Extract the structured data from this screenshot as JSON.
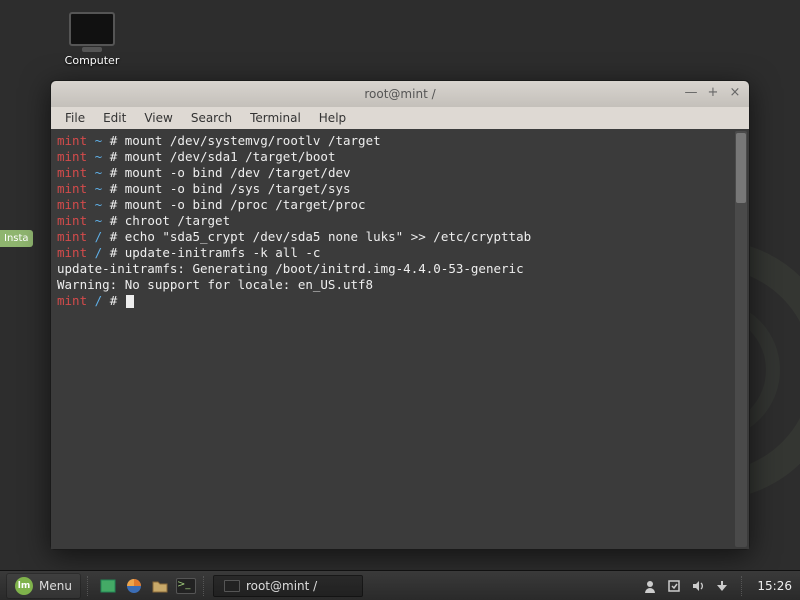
{
  "desktop": {
    "computer_label": "Computer",
    "install_tab": "Insta"
  },
  "window": {
    "title": "root@mint /",
    "menus": {
      "file": "File",
      "edit": "Edit",
      "view": "View",
      "search": "Search",
      "terminal": "Terminal",
      "help": "Help"
    },
    "controls": {
      "min": "—",
      "max": "+",
      "close": "×"
    }
  },
  "terminal": {
    "host": "mint",
    "lines": [
      {
        "path": "~",
        "cmd": "mount /dev/systemvg/rootlv /target"
      },
      {
        "path": "~",
        "cmd": "mount /dev/sda1 /target/boot"
      },
      {
        "path": "~",
        "cmd": "mount -o bind /dev /target/dev"
      },
      {
        "path": "~",
        "cmd": "mount -o bind /sys /target/sys"
      },
      {
        "path": "~",
        "cmd": "mount -o bind /proc /target/proc"
      },
      {
        "path": "~",
        "cmd": "chroot /target"
      },
      {
        "path": "/",
        "cmd": "echo \"sda5_crypt /dev/sda5 none luks\" >> /etc/crypttab"
      },
      {
        "path": "/",
        "cmd": "update-initramfs -k all -c"
      }
    ],
    "output": [
      "update-initramfs: Generating /boot/initrd.img-4.4.0-53-generic",
      "Warning: No support for locale: en_US.utf8"
    ],
    "prompt": {
      "path": "/",
      "cmd": ""
    }
  },
  "taskbar": {
    "menu_label": "Menu",
    "task_title": "root@mint /",
    "clock": "15:26"
  }
}
